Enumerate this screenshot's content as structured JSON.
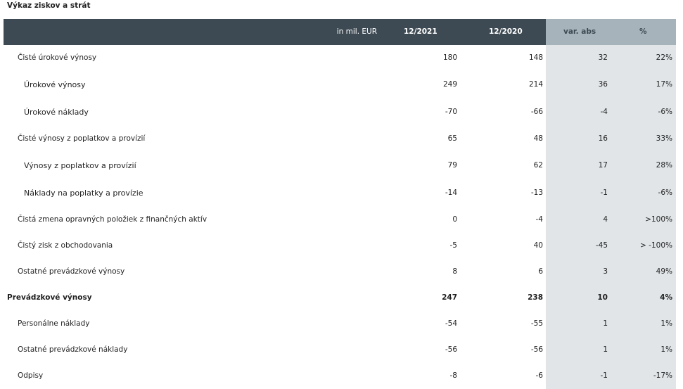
{
  "title": "Výkaz ziskov a strát",
  "header": {
    "unit": "in mil. EUR",
    "col1": "12/2021",
    "col2": "12/2020",
    "col3": "var. abs",
    "col4": "%"
  },
  "rows": [
    {
      "label": "Čisté úrokové výnosy",
      "v2021": "180",
      "v2020": "148",
      "abs": "32",
      "pct": "22%"
    },
    {
      "label": "Úrokové výnosy",
      "v2021": "249",
      "v2020": "214",
      "abs": "36",
      "pct": "17%"
    },
    {
      "label": "Úrokové náklady",
      "v2021": "-70",
      "v2020": "-66",
      "abs": "-4",
      "pct": "-6%"
    },
    {
      "label": "Čisté výnosy z poplatkov a provízií",
      "v2021": "65",
      "v2020": "48",
      "abs": "16",
      "pct": "33%"
    },
    {
      "label": "Výnosy z poplatkov a provízií",
      "v2021": "79",
      "v2020": "62",
      "abs": "17",
      "pct": "28%"
    },
    {
      "label": "Náklady na poplatky a provízie",
      "v2021": "-14",
      "v2020": "-13",
      "abs": "-1",
      "pct": "-6%"
    },
    {
      "label": "Čistá zmena opravných položiek z finančných aktív",
      "v2021": "0",
      "v2020": "-4",
      "abs": "4",
      "pct": ">100%"
    },
    {
      "label": "Čistý zisk z obchodovania",
      "v2021": "-5",
      "v2020": "40",
      "abs": "-45",
      "pct": "> -100%"
    },
    {
      "label": "Ostatné prevádzkové výnosy",
      "v2021": "8",
      "v2020": "6",
      "abs": "3",
      "pct": "49%"
    },
    {
      "label": "Prevádzkové výnosy",
      "v2021": "247",
      "v2020": "238",
      "abs": "10",
      "pct": "4%"
    },
    {
      "label": "Personálne náklady",
      "v2021": "-54",
      "v2020": "-55",
      "abs": "1",
      "pct": "1%"
    },
    {
      "label": "Ostatné prevádzkové náklady",
      "v2021": "-56",
      "v2020": "-56",
      "abs": "1",
      "pct": "1%"
    },
    {
      "label": "Odpisy",
      "v2021": "-8",
      "v2020": "-6",
      "abs": "-1",
      "pct": "-17%"
    }
  ]
}
